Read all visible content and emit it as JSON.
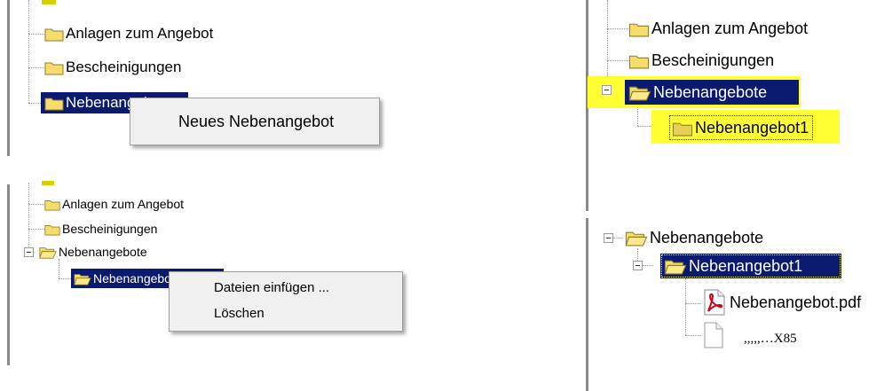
{
  "panel1": {
    "items": [
      "Anlagen zum Angebot",
      "Bescheinigungen",
      "Nebenangebote"
    ],
    "context_menu": [
      "Neues Nebenangebot"
    ]
  },
  "panel2": {
    "items": [
      "Anlagen zum Angebot",
      "Bescheinigungen",
      "Nebenangebote"
    ],
    "child": "Nebenangebot1"
  },
  "panel3": {
    "items": [
      "Anlagen zum Angebot",
      "Bescheinigungen",
      "Nebenangebote",
      "Nebenangebot1"
    ],
    "context_menu": [
      "Dateien einfügen ...",
      "Löschen"
    ]
  },
  "panel4": {
    "root": "Nebenangebote",
    "child": "Nebenangebot1",
    "files": [
      "Nebenangebot.pdf",
      ",,,,,…X85"
    ]
  },
  "colors": {
    "selection": "#0a1a6e",
    "highlight": "#ffff33",
    "folder": "#f6dc6a",
    "pdf": "#d0021b"
  },
  "icons": [
    "folder-icon",
    "folder-open-icon",
    "pdf-icon",
    "blank-file-icon",
    "tree-collapse-icon"
  ]
}
